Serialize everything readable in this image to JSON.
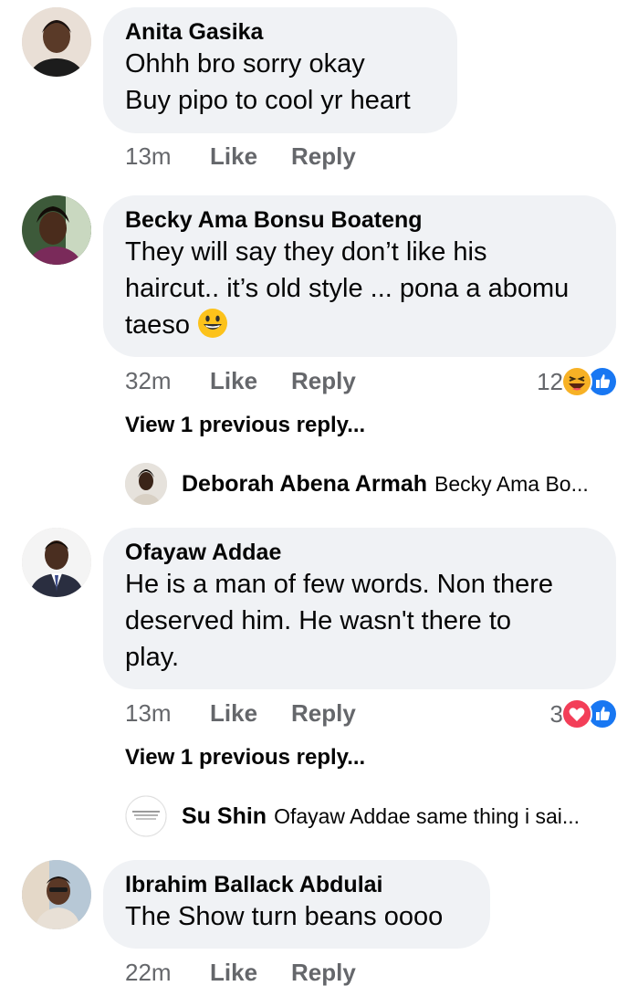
{
  "comments": [
    {
      "author": "Anita Gasika",
      "lines": [
        "Ohhh bro sorry okay",
        "Buy pipo to cool yr heart"
      ],
      "time": "13m",
      "like": "Like",
      "reply": "Reply"
    },
    {
      "author": "Becky Ama Bonsu Boateng",
      "lines": [
        "They will say they don’t like his",
        "haircut.. it’s old style ... pona a abomu",
        "taeso"
      ],
      "emoji": "grinning-face",
      "time": "32m",
      "like": "Like",
      "reply": "Reply",
      "reaction_count": "12",
      "reactions": [
        "haha",
        "like"
      ],
      "view_previous": "View 1 previous reply...",
      "reply_preview": {
        "author": "Deborah Abena Armah",
        "snippet": "Becky Ama Bo..."
      }
    },
    {
      "author": "Ofayaw Addae",
      "lines": [
        "He is a man of few words. Non there",
        "deserved him. He wasn't there to",
        "play."
      ],
      "time": "13m",
      "like": "Like",
      "reply": "Reply",
      "reaction_count": "3",
      "reactions": [
        "love",
        "like"
      ],
      "view_previous": "View 1 previous reply...",
      "reply_preview": {
        "author": "Su Shin",
        "snippet": "Ofayaw Addae same thing i sai..."
      }
    },
    {
      "author": "Ibrahim Ballack Abdulai",
      "lines": [
        "The Show turn beans oooo"
      ],
      "time": "22m",
      "like": "Like",
      "reply": "Reply"
    }
  ],
  "colors": {
    "bubble": "#f0f2f5",
    "meta": "#65676b",
    "like_blue": "#1877f2",
    "love_red": "#f33e58",
    "haha_yellow": "#f7b125"
  }
}
